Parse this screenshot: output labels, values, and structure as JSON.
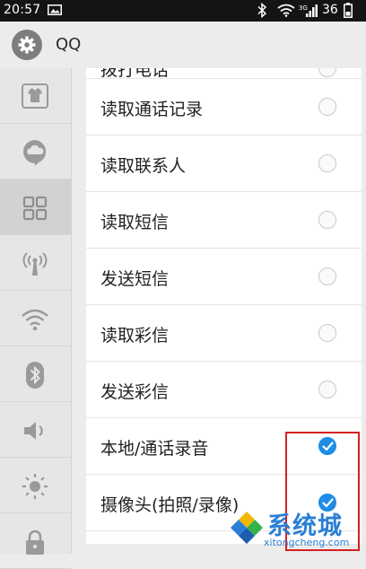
{
  "status_bar": {
    "time": "20:57",
    "network_label": "3G",
    "battery": "36"
  },
  "header": {
    "app_icon": "gear-icon",
    "title": "QQ"
  },
  "sidebar": {
    "items": [
      {
        "icon": "shirt-icon",
        "active": false
      },
      {
        "icon": "cloud-chat-icon",
        "active": false
      },
      {
        "icon": "apps-grid-icon",
        "active": true
      },
      {
        "icon": "antenna-icon",
        "active": false
      },
      {
        "icon": "wifi-icon",
        "active": false
      },
      {
        "icon": "bluetooth-icon",
        "active": false
      },
      {
        "icon": "volume-icon",
        "active": false
      },
      {
        "icon": "brightness-icon",
        "active": false
      },
      {
        "icon": "lock-icon",
        "active": false
      }
    ]
  },
  "permissions": {
    "partial_top_label": "拨打电话",
    "items": [
      {
        "label": "读取通话记录",
        "checked": false
      },
      {
        "label": "读取联系人",
        "checked": false
      },
      {
        "label": "读取短信",
        "checked": false
      },
      {
        "label": "发送短信",
        "checked": false
      },
      {
        "label": "读取彩信",
        "checked": false
      },
      {
        "label": "发送彩信",
        "checked": false
      },
      {
        "label": "本地/通话录音",
        "checked": true
      },
      {
        "label": "摄像头(拍照/录像)",
        "checked": true
      }
    ]
  },
  "colors": {
    "accent": "#1f8ce6",
    "highlight_box": "#d42020",
    "watermark": "#2a7fd4"
  },
  "watermark": {
    "brand": "系统城",
    "domain": "xitongcheng.com"
  }
}
